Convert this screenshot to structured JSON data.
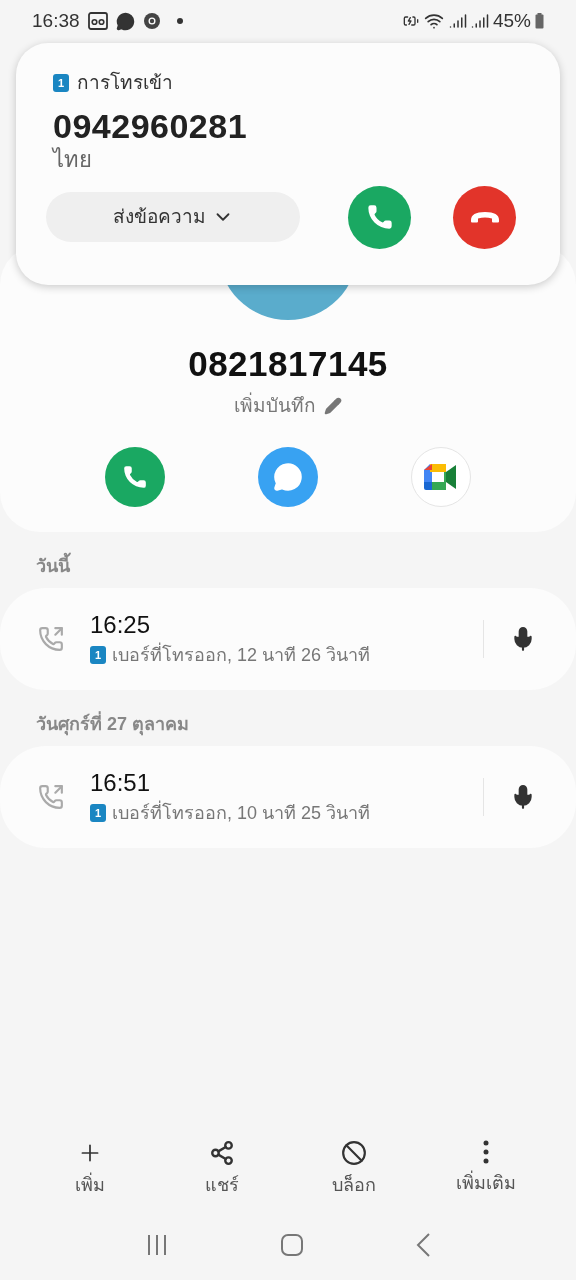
{
  "status_bar": {
    "time": "16:38",
    "battery": "45%"
  },
  "incoming_call": {
    "sim_badge": "1",
    "label": "การโทรเข้า",
    "number": "0942960281",
    "location": "ไทย",
    "reply_button": "ส่งข้อความ"
  },
  "contact": {
    "number": "0821817145",
    "note_button": "เพิ่มบันทึก"
  },
  "sections": [
    {
      "heading": "วันนี้",
      "calls": [
        {
          "time": "16:25",
          "sim_badge": "1",
          "detail": "เบอร์ที่โทรออก, 12 นาที 26 วินาที"
        }
      ]
    },
    {
      "heading": "วันศุกร์ที่ 27 ตุลาคม",
      "calls": [
        {
          "time": "16:51",
          "sim_badge": "1",
          "detail": "เบอร์ที่โทรออก, 10 นาที 25 วินาที"
        }
      ]
    }
  ],
  "toolbar": [
    {
      "kind": "add",
      "label": "เพิ่ม"
    },
    {
      "kind": "share",
      "label": "แชร์"
    },
    {
      "kind": "block",
      "label": "บล็อก"
    },
    {
      "kind": "more",
      "label": "เพิ่มเติม"
    }
  ]
}
